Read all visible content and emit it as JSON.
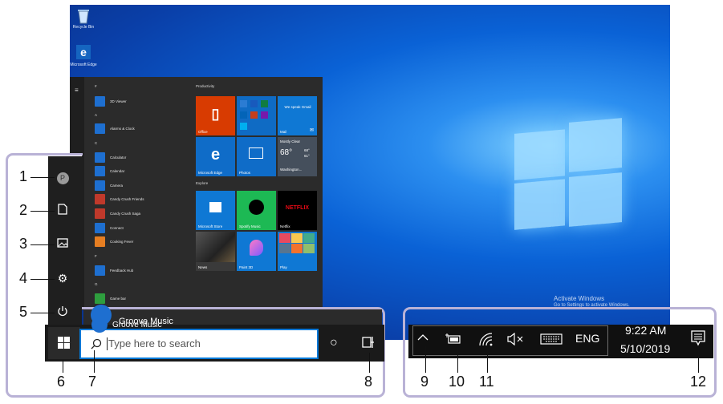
{
  "desktop": {
    "icons": [
      {
        "name": "recycle-bin",
        "label": "Recycle Bin"
      },
      {
        "name": "edge",
        "label": "Microsoft Edge"
      }
    ],
    "watermark": [
      "Activate Windows",
      "Go to Settings to activate Windows."
    ]
  },
  "start_menu": {
    "letters": [
      "#",
      "A",
      "C",
      "F",
      "G"
    ],
    "apps": [
      {
        "label": "3D Viewer",
        "color": "#1e6fd0"
      },
      {
        "label": "Alarms & Clock",
        "color": "#1e6fd0"
      },
      {
        "label": "Calculator",
        "color": "#1e6fd0"
      },
      {
        "label": "Calendar",
        "color": "#1e6fd0"
      },
      {
        "label": "Camera",
        "color": "#1e6fd0"
      },
      {
        "label": "Candy Crush Friends",
        "color": "#c0392b"
      },
      {
        "label": "Candy Crush Saga",
        "color": "#c0392b"
      },
      {
        "label": "Connect",
        "color": "#1e6fd0"
      },
      {
        "label": "Cooking Fever",
        "color": "#e67e22"
      },
      {
        "label": "Feedback Hub",
        "color": "#1e6fd0"
      },
      {
        "label": "Game bar",
        "color": "#2e9e3e"
      },
      {
        "label": "Groove Music",
        "color": "#1e6fd0"
      }
    ],
    "sections": [
      "Productivity",
      "Explore"
    ],
    "tiles": {
      "office": "Office",
      "mail_top": "We speak Gmail",
      "mail": "Mail",
      "edge": "Microsoft Edge",
      "photos": "Photos",
      "weather_top": "Mostly Clear",
      "weather_temp": "68°",
      "weather_hi": "68°",
      "weather_lo": "61°",
      "weather_city": "Washington...",
      "store": "Microsoft Store",
      "spotify": "Spotify Music",
      "netflix_logo": "NETFLIX",
      "netflix": "Netflix",
      "news": "News",
      "paint3d": "Paint 3D",
      "play": "Play"
    },
    "rail": [
      "user-icon",
      "document-icon",
      "pictures-icon",
      "settings-icon",
      "power-icon"
    ]
  },
  "taskbar": {
    "search_placeholder": "Type here to search",
    "cortana": "○"
  },
  "tray": {
    "language": "ENG",
    "time": "9:22 AM",
    "date": "5/10/2019"
  },
  "callouts": [
    "1",
    "2",
    "3",
    "4",
    "5",
    "6",
    "7",
    "8",
    "9",
    "10",
    "11",
    "12"
  ]
}
